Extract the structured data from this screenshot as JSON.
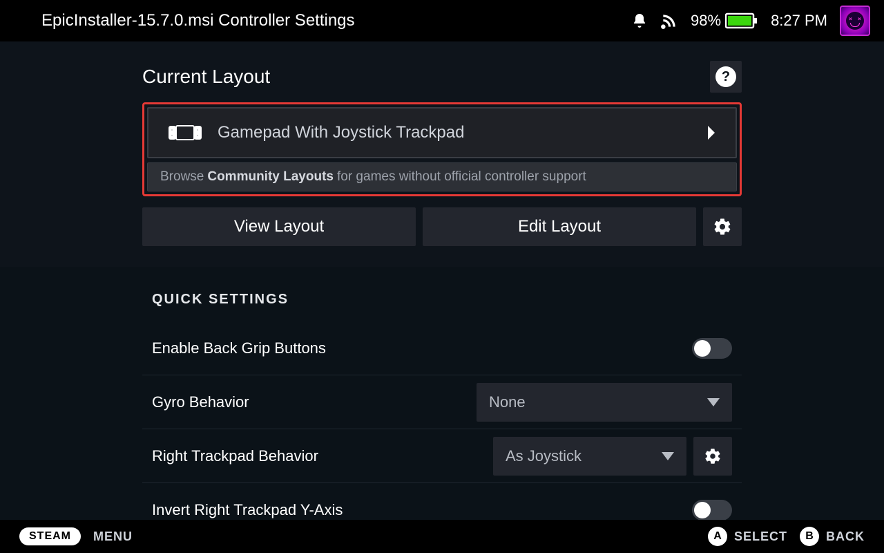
{
  "header": {
    "title": "EpicInstaller-15.7.0.msi Controller Settings",
    "battery_percent": "98%",
    "clock": "8:27 PM"
  },
  "layout": {
    "section_title": "Current Layout",
    "help_symbol": "?",
    "current_layout_name": "Gamepad With Joystick Trackpad",
    "browse_prefix": "Browse",
    "browse_bold": "Community Layouts",
    "browse_suffix": "for games without official controller support",
    "view_button": "View Layout",
    "edit_button": "Edit Layout"
  },
  "quick": {
    "heading": "QUICK SETTINGS",
    "rows": {
      "back_grip": "Enable Back Grip Buttons",
      "gyro": "Gyro Behavior",
      "gyro_value": "None",
      "right_trackpad": "Right Trackpad Behavior",
      "right_trackpad_value": "As Joystick",
      "invert_right": "Invert Right Trackpad Y-Axis"
    }
  },
  "footer": {
    "steam": "STEAM",
    "menu": "MENU",
    "hint_a_key": "A",
    "hint_a_label": "SELECT",
    "hint_b_key": "B",
    "hint_b_label": "BACK"
  }
}
